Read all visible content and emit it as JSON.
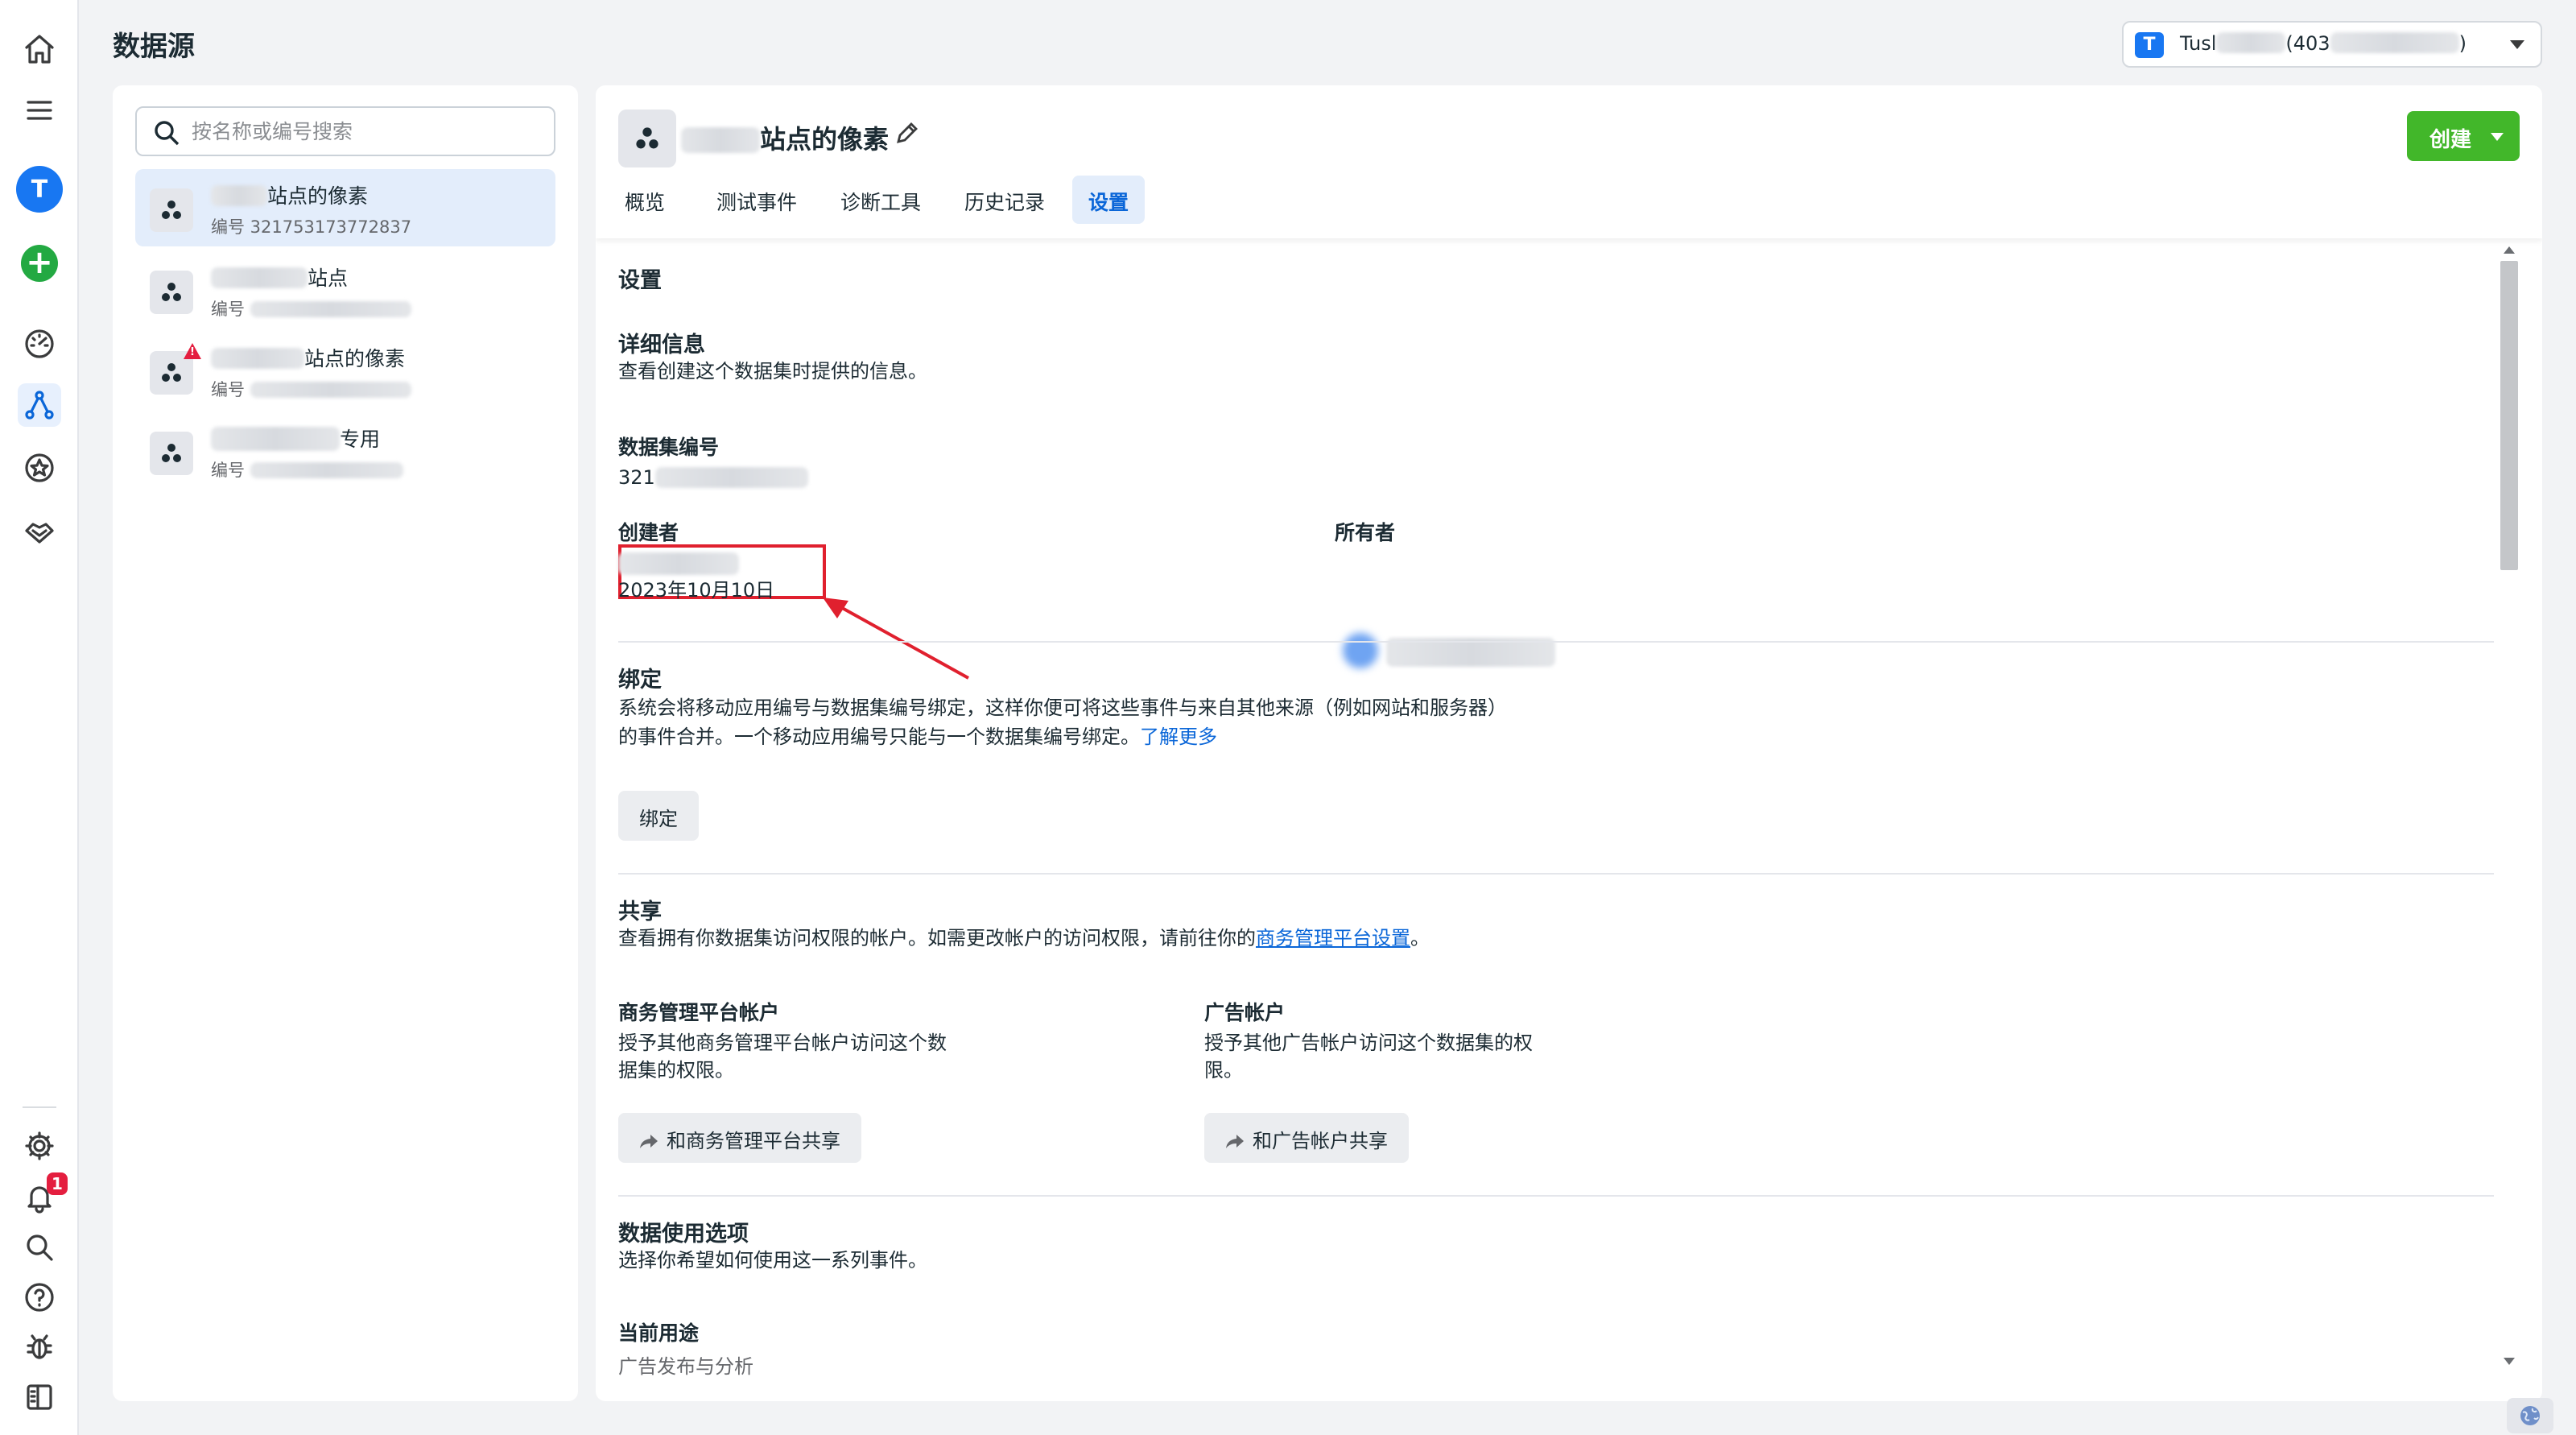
{
  "page": {
    "title": "数据源"
  },
  "account": {
    "badge": "T",
    "name": "Tusl",
    "id_prefix": "(403",
    "close_paren": ")"
  },
  "rail": {
    "avatar": "T",
    "notifications": "1"
  },
  "search": {
    "placeholder": "按名称或编号搜索"
  },
  "datasets": [
    {
      "name": "站点的像素",
      "id_label": "编号 321753173772837",
      "selected": true
    },
    {
      "name": "站点",
      "id_label": "编号"
    },
    {
      "name": "站点的像素",
      "id_label": "编号",
      "warning": true
    },
    {
      "name": "专用",
      "id_label": "编号"
    }
  ],
  "detail": {
    "title": "站点的像素",
    "create_label": "创建",
    "tabs": [
      {
        "label": "概览"
      },
      {
        "label": "测试事件"
      },
      {
        "label": "诊断工具"
      },
      {
        "label": "历史记录"
      },
      {
        "label": "设置",
        "active": true
      }
    ]
  },
  "settings": {
    "heading": "设置",
    "details": {
      "title": "详细信息",
      "desc": "查看创建这个数据集时提供的信息。",
      "dataset_id_label": "数据集编号",
      "dataset_id_value": "321",
      "creator_label": "创建者",
      "created_date": "2023年10月10日",
      "owner_label": "所有者"
    },
    "binding": {
      "title": "绑定",
      "desc_line1": "系统会将移动应用编号与数据集编号绑定，这样你便可将这些事件与来自其他来源（例如网站和服务器）",
      "desc_line2": "的事件合并。一个移动应用编号只能与一个数据集编号绑定。",
      "learn_more": "了解更多",
      "button": "绑定"
    },
    "sharing": {
      "title": "共享",
      "desc_prefix": "查看拥有你数据集访问权限的帐户。如需更改帐户的访问权限，请前往你的",
      "desc_link": "商务管理平台设置",
      "desc_suffix": "。",
      "bm_title": "商务管理平台帐户",
      "bm_desc_line1": "授予其他商务管理平台帐户访问这个数",
      "bm_desc_line2": "据集的权限。",
      "bm_button": "和商务管理平台共享",
      "ad_title": "广告帐户",
      "ad_desc_line1": "授予其他广告帐户访问这个数据集的权",
      "ad_desc_line2": "限。",
      "ad_button": "和广告帐户共享"
    },
    "usage": {
      "title": "数据使用选项",
      "desc": "选择你希望如何使用这一系列事件。",
      "current_label": "当前用途",
      "current_value": "广告发布与分析"
    }
  },
  "colors": {
    "accent": "#0a66d8",
    "create_green": "#42b72a",
    "annotation_red": "#e0202e"
  }
}
